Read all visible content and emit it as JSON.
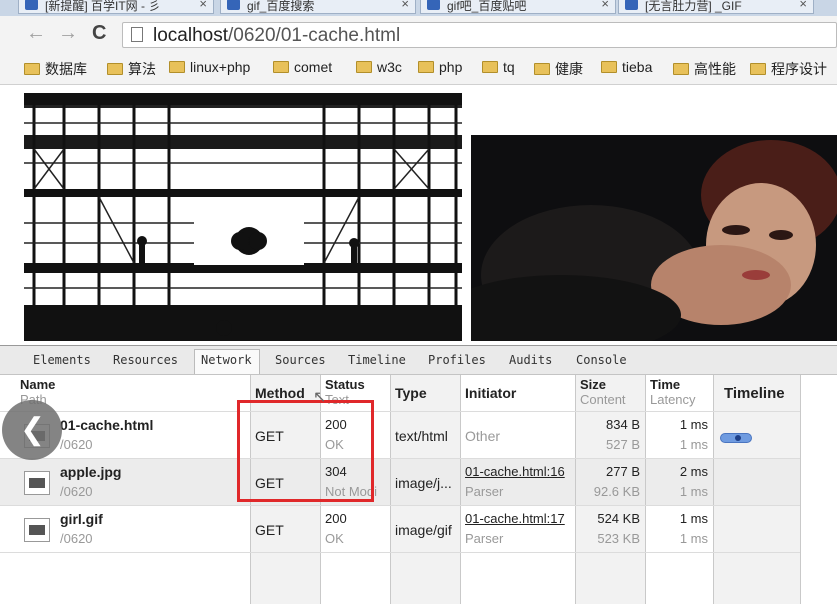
{
  "tabs": [
    {
      "title": "[新提醒] 百学IT网 - 彡",
      "close": "×"
    },
    {
      "title": "gif_百度搜索",
      "close": "×"
    },
    {
      "title": "gif吧_百度贴吧",
      "close": "×"
    },
    {
      "title": "[无言肚力营] _GIF",
      "close": "×"
    }
  ],
  "toolbar": {
    "back_icon": "←",
    "forward_icon": "→",
    "reload_icon": "C",
    "url_host": "localhost",
    "url_path": "/0620/01-cache.html"
  },
  "bookmarks": [
    "数据库",
    "算法",
    "linux+php",
    "comet",
    "w3c",
    "php",
    "tq",
    "健康",
    "tieba",
    "高性能",
    "程序设计"
  ],
  "devtools": {
    "tabs": [
      "Elements",
      "Resources",
      "Network",
      "Sources",
      "Timeline",
      "Profiles",
      "Audits",
      "Console"
    ],
    "headers": {
      "name": "Name",
      "name_sub": "Path",
      "method": "Method",
      "status": "Status",
      "status_sub": "Text",
      "type": "Type",
      "initiator": "Initiator",
      "size": "Size",
      "size_sub": "Content",
      "time": "Time",
      "time_sub": "Latency",
      "timeline": "Timeline"
    },
    "rows": [
      {
        "name": "01-cache.html",
        "path": "/0620",
        "method": "GET",
        "status": "200",
        "status_text": "OK",
        "type": "text/html",
        "initiator": "Other",
        "initiator_sub": "",
        "size": "834 B",
        "content": "527 B",
        "time": "1 ms",
        "latency": "1 ms"
      },
      {
        "name": "apple.jpg",
        "path": "/0620",
        "method": "GET",
        "status": "304",
        "status_text": "Not Modi",
        "type": "image/j...",
        "initiator": "01-cache.html:16",
        "initiator_sub": "Parser",
        "size": "277 B",
        "content": "92.6 KB",
        "time": "2 ms",
        "latency": "1 ms"
      },
      {
        "name": "girl.gif",
        "path": "/0620",
        "method": "GET",
        "status": "200",
        "status_text": "OK",
        "type": "image/gif",
        "initiator": "01-cache.html:17",
        "initiator_sub": "Parser",
        "size": "524 KB",
        "content": "523 KB",
        "time": "1 ms",
        "latency": "1 ms"
      }
    ]
  },
  "colors": {
    "highlight_box": "#e0282a",
    "timeline_bar": "#6f9be0"
  }
}
